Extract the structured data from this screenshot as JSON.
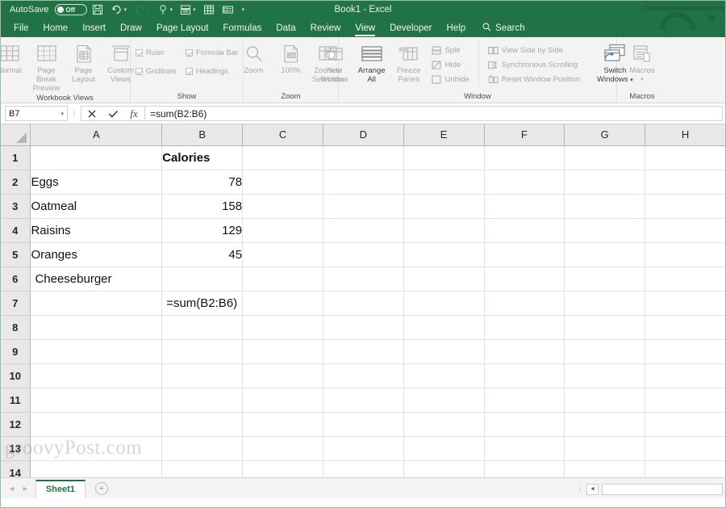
{
  "titlebar": {
    "autosave_label": "AutoSave",
    "autosave_state": "Off",
    "title": "Book1  -  Excel",
    "icons": [
      "save-icon",
      "undo-icon",
      "redo-icon",
      "touch-mode-icon",
      "quick-print-icon",
      "table-icon",
      "card-icon",
      "customize-qat-icon"
    ]
  },
  "tabs": [
    {
      "label": "File",
      "active": false
    },
    {
      "label": "Home",
      "active": false
    },
    {
      "label": "Insert",
      "active": false
    },
    {
      "label": "Draw",
      "active": false
    },
    {
      "label": "Page Layout",
      "active": false
    },
    {
      "label": "Formulas",
      "active": false
    },
    {
      "label": "Data",
      "active": false
    },
    {
      "label": "Review",
      "active": false
    },
    {
      "label": "View",
      "active": true
    },
    {
      "label": "Developer",
      "active": false
    },
    {
      "label": "Help",
      "active": false
    }
  ],
  "search": {
    "placeholder": "Search",
    "label": "Search"
  },
  "ribbon": {
    "groups": [
      {
        "title": "Workbook Views",
        "buttons": [
          {
            "label_top": "Normal",
            "label_bottom": "",
            "icon": "normal-view-icon"
          },
          {
            "label_top": "Page Break",
            "label_bottom": "Preview",
            "icon": "page-break-preview-icon"
          },
          {
            "label_top": "Page",
            "label_bottom": "Layout",
            "icon": "page-layout-icon"
          },
          {
            "label_top": "Custom",
            "label_bottom": "Views",
            "icon": "custom-views-icon"
          }
        ]
      },
      {
        "title": "Show",
        "checks": [
          {
            "label": "Ruler",
            "checked": true
          },
          {
            "label": "Formula Bar",
            "checked": true
          },
          {
            "label": "Gridlines",
            "checked": true
          },
          {
            "label": "Headings",
            "checked": true
          }
        ]
      },
      {
        "title": "Zoom",
        "buttons": [
          {
            "label_top": "Zoom",
            "label_bottom": "",
            "icon": "zoom-icon"
          },
          {
            "label_top": "100%",
            "label_bottom": "",
            "icon": "zoom-100-icon"
          },
          {
            "label_top": "Zoom to",
            "label_bottom": "Selection",
            "icon": "zoom-to-selection-icon"
          }
        ]
      },
      {
        "title": "Window",
        "buttons": [
          {
            "label_top": "New",
            "label_bottom": "Window",
            "icon": "new-window-icon"
          },
          {
            "label_top": "Arrange",
            "label_bottom": "All",
            "icon": "arrange-all-icon",
            "enabled": true
          },
          {
            "label_top": "Freeze",
            "label_bottom": "Panes",
            "icon": "freeze-panes-icon",
            "caret": true
          }
        ],
        "small_a": [
          {
            "label": "Split",
            "icon": "split-icon"
          },
          {
            "label": "Hide",
            "icon": "hide-icon"
          },
          {
            "label": "Unhide",
            "icon": "unhide-icon"
          }
        ],
        "small_b": [
          {
            "label": "View Side by Side",
            "icon": "view-side-by-side-icon"
          },
          {
            "label": "Synchronous Scrolling",
            "icon": "synchronous-scrolling-icon"
          },
          {
            "label": "Reset Window Position",
            "icon": "reset-window-position-icon"
          }
        ],
        "switch_windows": {
          "label_top": "Switch",
          "label_bottom": "Windows",
          "icon": "switch-windows-icon",
          "caret": true
        }
      },
      {
        "title": "Macros",
        "buttons": [
          {
            "label_top": "Macros",
            "label_bottom": "",
            "icon": "macros-icon",
            "caret": true
          }
        ]
      }
    ]
  },
  "formula_bar": {
    "name_box": "B7",
    "cancel_icon": "cancel-icon",
    "enter_icon": "enter-icon",
    "function_icon": "insert-function-icon",
    "value": "=sum(B2:B6)"
  },
  "sheet": {
    "columns": [
      "A",
      "B",
      "C",
      "D",
      "E",
      "F",
      "G",
      "H"
    ],
    "rows": [
      "1",
      "2",
      "3",
      "4",
      "5",
      "6",
      "7",
      "8",
      "9",
      "10",
      "11",
      "12",
      "13",
      "14"
    ],
    "cells": [
      {
        "row": "1",
        "col": "B",
        "value": "Calories",
        "bold": true,
        "align": "left"
      },
      {
        "row": "2",
        "col": "A",
        "value": "Eggs",
        "align": "left"
      },
      {
        "row": "2",
        "col": "B",
        "value": "78",
        "align": "right"
      },
      {
        "row": "3",
        "col": "A",
        "value": "Oatmeal",
        "align": "left"
      },
      {
        "row": "3",
        "col": "B",
        "value": "158",
        "align": "right"
      },
      {
        "row": "4",
        "col": "A",
        "value": "Raisins",
        "align": "left"
      },
      {
        "row": "4",
        "col": "B",
        "value": "129",
        "align": "right"
      },
      {
        "row": "5",
        "col": "A",
        "value": "Oranges",
        "align": "left"
      },
      {
        "row": "5",
        "col": "B",
        "value": "45",
        "align": "right"
      },
      {
        "row": "6",
        "col": "A",
        "value": "Cheeseburger",
        "align": "left",
        "overflow": true
      },
      {
        "row": "7",
        "col": "B",
        "value": "=sum(B2:B6)",
        "align": "left",
        "overflow": true
      }
    ]
  },
  "bottom": {
    "sheet_tab": "Sheet1",
    "add_sheet": "+",
    "prev_arrow": "◄",
    "next_arrow": "►",
    "scroll_left_arrow": "◄"
  },
  "watermark": "groovyPost.com",
  "colors": {
    "excel_green": "#217346",
    "ribbon_bg": "#f3f3f3",
    "header_bg": "#e8e8e8",
    "gridline": "#e2e2e2"
  }
}
